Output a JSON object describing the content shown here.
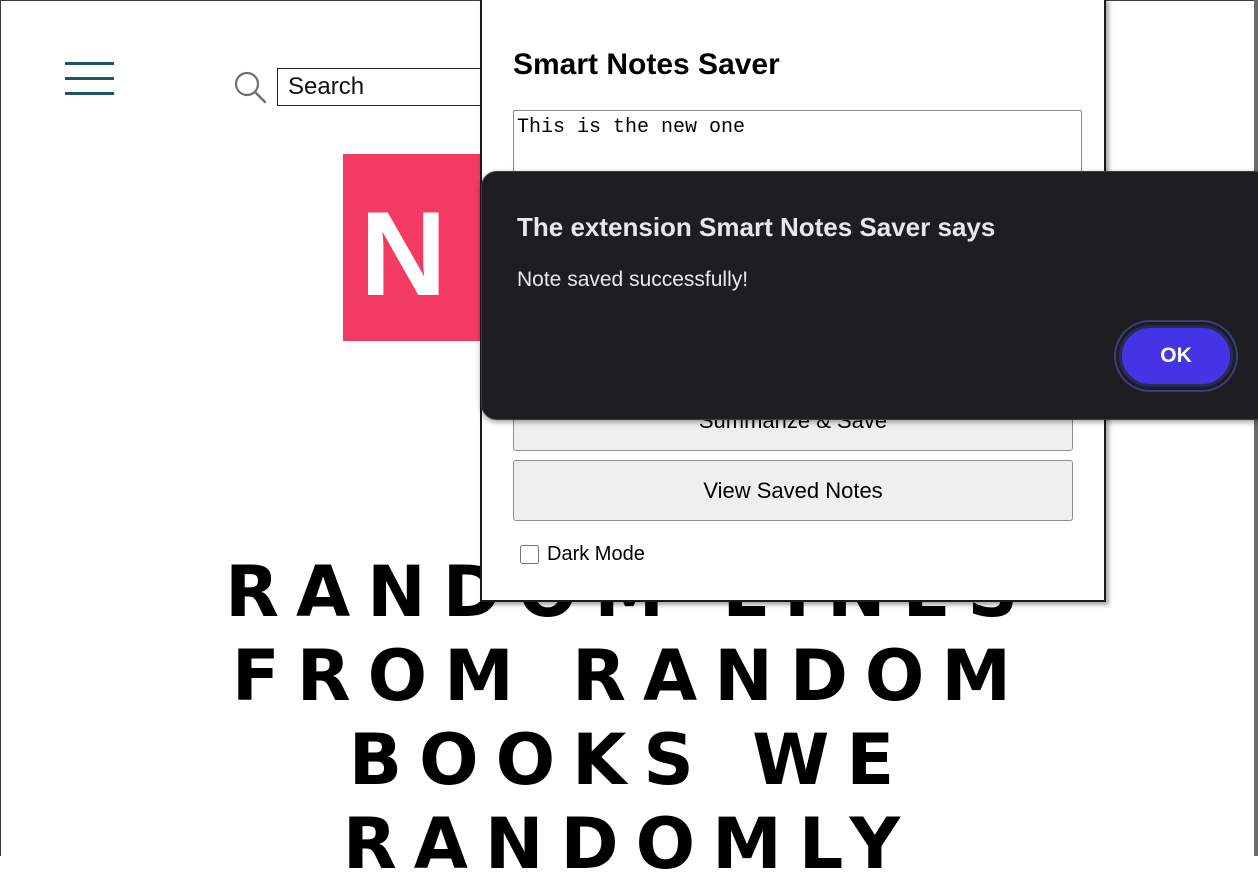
{
  "page": {
    "search_placeholder": "Search",
    "logo_letter": "N",
    "logo_color": "#f23a63",
    "headline": "Random Lines From Random Books We Randomly"
  },
  "popup": {
    "title": "Smart Notes Saver",
    "note_text": "This is the new one",
    "summarize_button": "Summarize & Save",
    "view_notes_button": "View Saved Notes",
    "dark_mode_label": "Dark Mode",
    "dark_mode_checked": false
  },
  "alert": {
    "title": "The extension Smart Notes Saver says",
    "message": "Note saved successfully!",
    "ok_label": "OK",
    "accent_color": "#4434e6"
  }
}
